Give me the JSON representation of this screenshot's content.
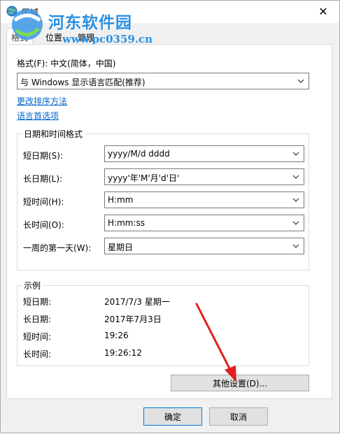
{
  "window": {
    "title": "区域",
    "close_glyph": "✕"
  },
  "watermark": {
    "name": "河东软件园",
    "url": "www.pc0359.cn"
  },
  "tabs": [
    {
      "label": "格式",
      "active": true
    },
    {
      "label": "位置",
      "active": false
    },
    {
      "label": "管理",
      "active": false
    }
  ],
  "format": {
    "label": "格式(F): 中文(简体，中国)",
    "selected": "与 Windows 显示语言匹配(推荐)"
  },
  "links": {
    "sort": "更改排序方法",
    "language": "语言首选项"
  },
  "datetime": {
    "title": "日期和时间格式",
    "rows": [
      {
        "label": "短日期(S):",
        "value": "yyyy/M/d dddd"
      },
      {
        "label": "长日期(L):",
        "value": "yyyy'年'M'月'd'日'"
      },
      {
        "label": "短时间(H):",
        "value": "H:mm"
      },
      {
        "label": "长时间(O):",
        "value": "H:mm:ss"
      },
      {
        "label": "一周的第一天(W):",
        "value": "星期日"
      }
    ]
  },
  "example": {
    "title": "示例",
    "rows": [
      {
        "label": "短日期:",
        "value": "2017/7/3 星期一"
      },
      {
        "label": "长日期:",
        "value": "2017年7月3日"
      },
      {
        "label": "短时间:",
        "value": "19:26"
      },
      {
        "label": "长时间:",
        "value": "19:26:12"
      }
    ]
  },
  "buttons": {
    "other": "其他设置(D)...",
    "ok": "确定",
    "cancel": "取消"
  },
  "colors": {
    "accent": "#0078d7",
    "link": "#0066cc",
    "annotation_arrow": "#e02020"
  }
}
